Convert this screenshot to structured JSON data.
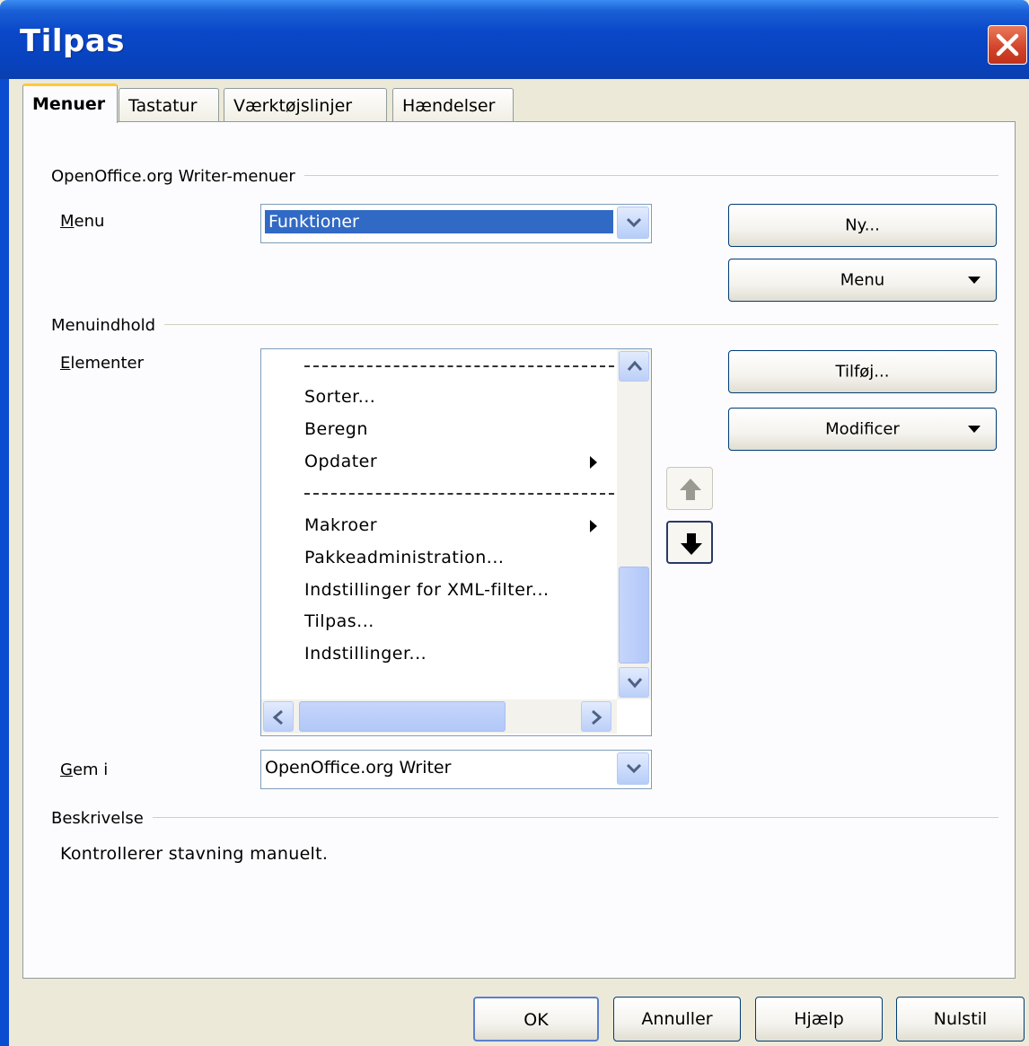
{
  "window": {
    "title": "Tilpas"
  },
  "tabs": [
    {
      "label": "Menuer",
      "active": true
    },
    {
      "label": "Tastatur",
      "active": false
    },
    {
      "label": "Værktøjslinjer",
      "active": false
    },
    {
      "label": "Hændelser",
      "active": false
    }
  ],
  "menus_group": {
    "heading": "OpenOffice.org Writer-menuer",
    "menu_label": "Menu",
    "menu_value": "Funktioner",
    "new_button": "Ny...",
    "menu_button": "Menu"
  },
  "content_group": {
    "heading": "Menuindhold",
    "elements_label": "Elementer",
    "items": [
      {
        "type": "separator"
      },
      {
        "type": "item",
        "label": "Sorter..."
      },
      {
        "type": "item",
        "label": "Beregn"
      },
      {
        "type": "item",
        "label": "Opdater",
        "submenu": true
      },
      {
        "type": "separator"
      },
      {
        "type": "item",
        "label": "Makroer",
        "submenu": true
      },
      {
        "type": "item",
        "label": "Pakkeadministration..."
      },
      {
        "type": "item",
        "label": "Indstillinger for XML-filter..."
      },
      {
        "type": "item",
        "label": "Tilpas..."
      },
      {
        "type": "item",
        "label": "Indstillinger..."
      }
    ],
    "add_button": "Tilføj...",
    "modify_button": "Modificer"
  },
  "save_in": {
    "label": "Gem i",
    "value": "OpenOffice.org Writer"
  },
  "description": {
    "heading": "Beskrivelse",
    "text": "Kontrollerer stavning manuelt."
  },
  "buttons": {
    "ok": "OK",
    "cancel": "Annuller",
    "help": "Hjælp",
    "reset": "Nulstil"
  },
  "colors": {
    "titlebar": "#0a48c9",
    "selection": "#316ac5",
    "dialog_bg": "#ece9d8",
    "tab_highlight": "#ffc83c"
  }
}
